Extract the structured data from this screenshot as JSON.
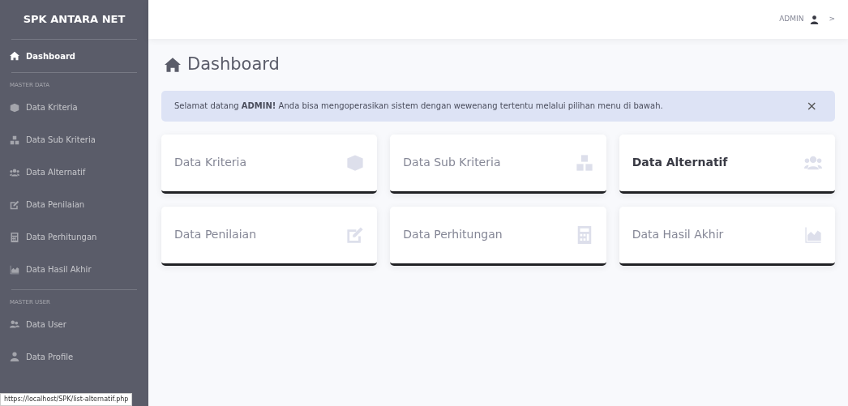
{
  "sidebar": {
    "brand": "SPK ANTARA NET",
    "top_items": [
      {
        "label": "Dashboard",
        "selected": true
      }
    ],
    "sections": [
      {
        "heading": "MASTER DATA",
        "items": [
          {
            "label": "Data Kriteria",
            "selected": false
          },
          {
            "label": "Data Sub Kriteria",
            "selected": false
          },
          {
            "label": "Data Alternatif",
            "selected": false
          },
          {
            "label": "Data Penilaian",
            "selected": false
          },
          {
            "label": "Data Perhitungan",
            "selected": false
          },
          {
            "label": "Data Hasil Akhir",
            "selected": false
          }
        ]
      },
      {
        "heading": "MASTER USER",
        "items": [
          {
            "label": "Data User",
            "selected": false
          },
          {
            "label": "Data Profile",
            "selected": false
          }
        ]
      }
    ]
  },
  "topbar": {
    "user": "ADMIN",
    "chevron": ">"
  },
  "page_title": "Dashboard",
  "alert": {
    "message": "Selamat datang **ADMIN!** Anda bisa mengoperasikan sistem dengan wewenang tertentu melalui pilihan menu di bawah.",
    "close": "×"
  },
  "cards": [
    {
      "label": "Data Kriteria",
      "hovered": false
    },
    {
      "label": "Data Sub Kriteria",
      "hovered": false
    },
    {
      "label": "Data Alternatif",
      "hovered": true
    },
    {
      "label": "Data Penilaian",
      "hovered": false
    },
    {
      "label": "Data Perhitungan",
      "hovered": false
    },
    {
      "label": "Data Hasil Akhir",
      "hovered": false
    }
  ],
  "status_bar": {
    "url": "https://localhost/SPK/list-alternatif.php"
  }
}
